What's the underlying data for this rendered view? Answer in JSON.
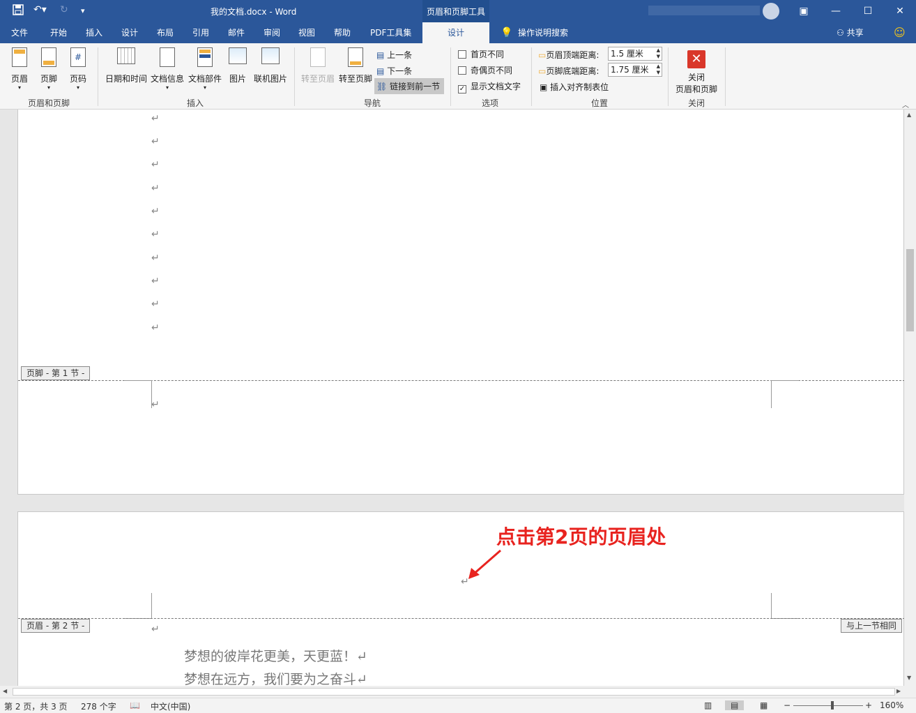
{
  "title": {
    "doc": "我的文档.docx",
    "sep": "-",
    "app": "Word",
    "context_tab": "页眉和页脚工具"
  },
  "tabs": [
    "文件",
    "开始",
    "插入",
    "设计",
    "布局",
    "引用",
    "邮件",
    "审阅",
    "视图",
    "帮助",
    "PDF工具集"
  ],
  "active_tab": "设计",
  "search": "操作说明搜索",
  "share": "共享",
  "groups": {
    "hf": {
      "label": "页眉和页脚",
      "buttons": [
        "页眉",
        "页脚",
        "页码"
      ]
    },
    "insert": {
      "label": "插入",
      "buttons": [
        "日期和时间",
        "文档信息",
        "文档部件",
        "图片",
        "联机图片"
      ]
    },
    "nav": {
      "label": "导航",
      "buttons": [
        "转至页眉",
        "转至页脚"
      ],
      "small": [
        "上一条",
        "下一条",
        "链接到前一节"
      ]
    },
    "options": {
      "label": "选项",
      "items": [
        "首页不同",
        "奇偶页不同",
        "显示文档文字"
      ],
      "checked": [
        false,
        false,
        true
      ]
    },
    "position": {
      "label": "位置",
      "header_dist_label": "页眉顶端距离:",
      "header_dist": "1.5 厘米",
      "footer_dist_label": "页脚底端距离:",
      "footer_dist": "1.75 厘米",
      "align_tab": "插入对齐制表位"
    },
    "close": {
      "label": "关闭",
      "btn_line1": "关闭",
      "btn_line2": "页眉和页脚"
    }
  },
  "document": {
    "para_mark": "↵",
    "footer_tag": "页脚 - 第 1 节 -",
    "header_tag": "页眉 - 第 2 节 -",
    "same_as_prev": "与上一节相同",
    "annotation": "点击第2页的页眉处",
    "annotation_color": "#e8231f",
    "lines": [
      "梦想的彼岸花更美，天更蓝！↵",
      "梦想在远方，我们要为之奋斗↵"
    ]
  },
  "status": {
    "page": "第 2 页，共 3 页",
    "words": "278 个字",
    "lang": "中文(中国)",
    "zoom": "160%"
  }
}
